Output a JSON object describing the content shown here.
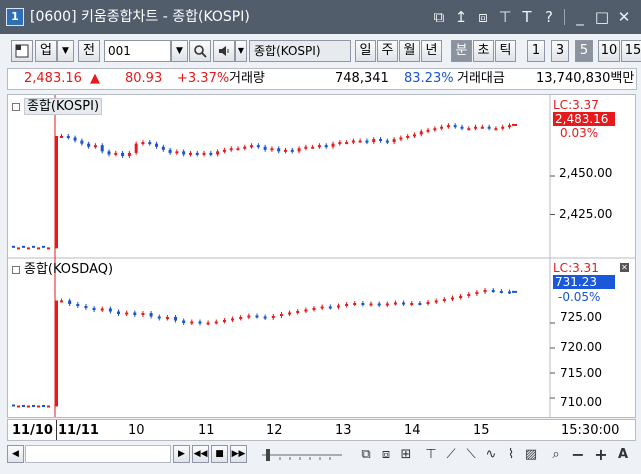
{
  "window": {
    "badge": "1",
    "title": "[0600] 키움종합차트 - 종합(KOSPI)",
    "icons": [
      "link-icon",
      "pin-top-icon",
      "window-copy-icon",
      "ticker-icon",
      "text-icon",
      "help-icon",
      "minimize-icon",
      "maximize-icon",
      "close-icon"
    ],
    "icon_glyphs": [
      "⧉",
      "↥",
      "⧈",
      "⊤",
      "T",
      "?",
      "_",
      "□",
      "✕"
    ]
  },
  "toolbar": {
    "market_select": "업",
    "all_label": "전",
    "code_value": "001",
    "name_value": "종합(KOSPI)",
    "period_buttons": [
      "일",
      "주",
      "월",
      "년",
      "분",
      "초",
      "틱"
    ],
    "active_period": "분",
    "interval_buttons": [
      "1",
      "3",
      "5",
      "10",
      "15"
    ],
    "active_interval": "5"
  },
  "quote": {
    "price": "2,483.16",
    "direction": "▲",
    "change": "80.93",
    "change_pct": "+3.37%",
    "volume_label": "거래량",
    "volume": "748,341",
    "volume_ratio": "83.23%",
    "amount_label": "거래대금",
    "amount": "13,740,830백만"
  },
  "charts": [
    {
      "name": "종합(KOSPI)",
      "lc": "LC:3.37",
      "last": "2,483.16",
      "change_pct": "0.03%",
      "y_ticks": [
        "2,450.00",
        "2,425.00"
      ],
      "y_tick_values": [
        2450,
        2425
      ],
      "ylim": [
        2400,
        2500
      ],
      "prev_session": [
        2404,
        2403,
        2404,
        2403,
        2404,
        2403,
        2404,
        2403
      ],
      "session": [
        2476,
        2475,
        2473,
        2471,
        2469,
        2470,
        2466,
        2464,
        2465,
        2463,
        2465,
        2471,
        2472,
        2471,
        2469,
        2467,
        2465,
        2466,
        2464,
        2465,
        2464,
        2465,
        2464,
        2466,
        2467,
        2468,
        2468,
        2469,
        2470,
        2469,
        2467,
        2468,
        2466,
        2467,
        2466,
        2468,
        2469,
        2469,
        2470,
        2469,
        2471,
        2472,
        2472,
        2473,
        2473,
        2472,
        2474,
        2473,
        2472,
        2474,
        2475,
        2476,
        2477,
        2479,
        2480,
        2481,
        2482,
        2483,
        2482,
        2481,
        2481,
        2482,
        2482,
        2481,
        2481,
        2482,
        2483
      ],
      "last_value": 2483.16,
      "line_color": "#d71e1e"
    },
    {
      "name": "종합(KOSDAQ)",
      "lc": "LC:3.31",
      "last": "731.23",
      "change_pct": "-0.05%",
      "y_ticks": [
        "725.00",
        "720.00",
        "715.00",
        "710.00"
      ],
      "y_tick_values": [
        725,
        720,
        715,
        710
      ],
      "ylim": [
        707,
        737
      ],
      "prev_session": [
        708.5,
        708.3,
        708.4,
        708.3,
        708.4,
        708.3,
        708.4,
        708.3
      ],
      "session": [
        729.5,
        728.8,
        728.4,
        728.0,
        727.6,
        727.9,
        727.3,
        726.8,
        727.1,
        726.6,
        727.0,
        726.3,
        725.9,
        726.2,
        725.5,
        725.0,
        725.3,
        724.9,
        725.1,
        725.3,
        725.6,
        725.9,
        726.2,
        726.5,
        726.3,
        726.0,
        726.4,
        726.8,
        727.1,
        727.4,
        727.7,
        728.0,
        728.3,
        728.1,
        728.5,
        728.8,
        729.0,
        728.7,
        728.9,
        728.6,
        728.9,
        729.1,
        728.8,
        729.0,
        728.9,
        729.2,
        729.5,
        729.8,
        730.1,
        730.4,
        730.8,
        731.2,
        731.6,
        731.4,
        731.3,
        731.2
      ],
      "last_value": 731.23,
      "line_color": "#d71e1e"
    }
  ],
  "x_axis": {
    "labels": [
      "11/10",
      "11/11",
      "10",
      "11",
      "12",
      "13",
      "14",
      "15"
    ],
    "time": "15:30:00"
  },
  "colors": {
    "up": "#e8191a",
    "down": "#1753d6",
    "title_bg": "#515d6b",
    "last_up_bg": "#e8191a",
    "last_down_bg": "#1b57d9"
  }
}
